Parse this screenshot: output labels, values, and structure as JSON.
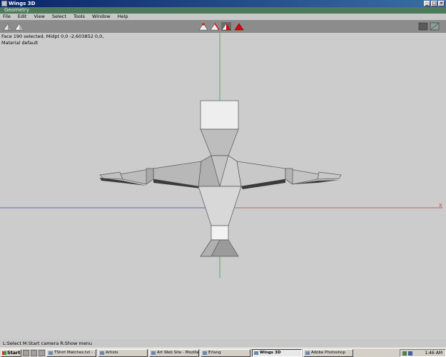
{
  "window": {
    "title": "Wings 3D",
    "controls": [
      "_",
      "□",
      "×"
    ]
  },
  "geometry_bar": {
    "title": "Geometry"
  },
  "menu": [
    "File",
    "Edit",
    "View",
    "Select",
    "Tools",
    "Window",
    "Help"
  ],
  "toolbar": {
    "left_icons": [
      "view-mode-icon",
      "view-mode-icon"
    ],
    "selection_modes": [
      "vertex",
      "edge",
      "face",
      "body"
    ],
    "selected_mode": "face",
    "accent_color": "#e00000"
  },
  "viewport": {
    "info_line1": "Face 190 selected, Midpt 0,0 -2,603852 0,0,",
    "info_line2": "Material default",
    "axis_x_label": "X",
    "axis_colors": {
      "x": "#c04040",
      "y": "#40a040",
      "z": "#4040c0"
    },
    "background": "#cccccc"
  },
  "statusbar": {
    "text": "L:Select  M:Start camera  R:Show menu"
  },
  "taskbar": {
    "start_label": "Start",
    "tasks": [
      {
        "label": "TShirt Matches.txt - ...",
        "active": false
      },
      {
        "label": "Artists",
        "active": false
      },
      {
        "label": "Art Web Site - Mozilla",
        "active": false
      },
      {
        "label": "Erlang",
        "active": false
      },
      {
        "label": "Wings 3D",
        "active": true
      },
      {
        "label": "Adobe Photoshop",
        "active": false
      }
    ],
    "clock": "1:46 AM"
  }
}
